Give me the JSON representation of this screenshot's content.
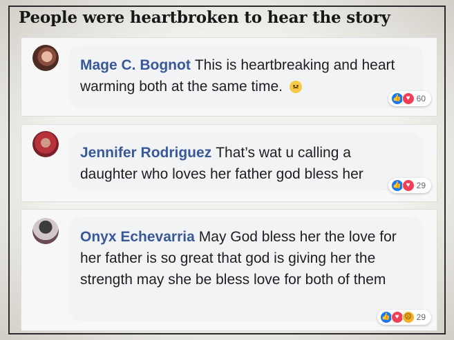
{
  "headline": "People were heartbroken to hear the story",
  "comments": [
    {
      "author": "Mage C. Bognot",
      "text": "This is heartbreaking and heart warming both at the same time.",
      "trailing_emoji": "sad-face-emoji",
      "reactions": [
        "like",
        "love"
      ],
      "reaction_count": "60"
    },
    {
      "author": "Jennifer Rodriguez",
      "text": "That’s wat u calling a daughter who loves her father god bless her",
      "reactions": [
        "like",
        "love"
      ],
      "reaction_count": "29"
    },
    {
      "author": "Onyx Echevarria",
      "text": "May God bless her the love for her father is so great that god is giving her the strength may she be bless love for both of them",
      "reactions": [
        "like",
        "love",
        "sad"
      ],
      "reaction_count": "29"
    }
  ],
  "colors": {
    "author": "#385898",
    "like": "#1877f2",
    "love": "#f33e58",
    "sad": "#f7b125"
  }
}
